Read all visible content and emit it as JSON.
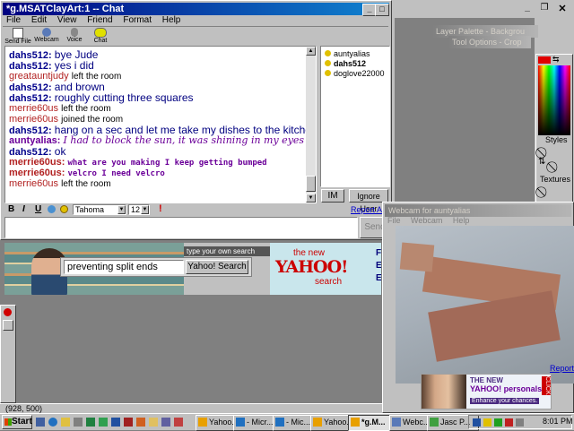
{
  "chat_window": {
    "title": "*g.MSATClayArt:1 -- Chat",
    "menu": [
      "File",
      "Edit",
      "View",
      "Friend",
      "Format",
      "Help"
    ],
    "toolbar": [
      {
        "label": "Send File",
        "icon": "send-file-icon"
      },
      {
        "label": "Webcam",
        "icon": "webcam-icon"
      },
      {
        "label": "Voice",
        "icon": "voice-icon"
      },
      {
        "label": "Chat",
        "icon": "chat-icon"
      }
    ],
    "messages": [
      {
        "nick": "dahs512:",
        "text": "bye Jude",
        "type": "msg"
      },
      {
        "nick": "dahs512:",
        "text": "yes i did",
        "type": "msg"
      },
      {
        "nick": "greatauntjudy",
        "text": "left the room",
        "type": "sys"
      },
      {
        "nick": "dahs512:",
        "text": "and brown",
        "type": "msg"
      },
      {
        "nick": "dahs512:",
        "text": "roughly cutting three squares",
        "type": "msg"
      },
      {
        "nick": "merrie60us",
        "text": "left the room",
        "type": "sys"
      },
      {
        "nick": "merrie60us",
        "text": "joined the room",
        "type": "sys"
      },
      {
        "nick": "dahs512:",
        "text": "hang on a sec and let me take my dishes to the kitchen",
        "type": "msg"
      },
      {
        "nick": "auntyalias:",
        "text": "I had to block the sun, it was shining in my eyes",
        "type": "script"
      },
      {
        "nick": "dahs512:",
        "text": "ok",
        "type": "msg"
      },
      {
        "nick": "merrie60us:",
        "text": "what are you making I keep getting bumped",
        "type": "purple"
      },
      {
        "nick": "merrie60us:",
        "text": "velcro I need velcro",
        "type": "purple"
      },
      {
        "nick": "merrie60us",
        "text": "left the room",
        "type": "sys"
      }
    ],
    "users": [
      {
        "name": "auntyalias",
        "bold": false
      },
      {
        "name": "dahs512",
        "bold": true
      },
      {
        "name": "doglove22000",
        "bold": false
      }
    ],
    "im_button": "IM",
    "ignore_button": "Ignore User",
    "format": {
      "bold": "B",
      "italic": "I",
      "underline": "U",
      "font": "Tahoma",
      "size": "12"
    },
    "report_abuse": "Report Abu",
    "send_button": "Send"
  },
  "ad": {
    "tag": "type your own search",
    "search_value": "preventing split ends",
    "search_button": "Yahoo! Search",
    "the_new": "the new",
    "brand": "YAHOO!",
    "search_word": "search",
    "side_letters": [
      "F",
      "E",
      "E"
    ]
  },
  "webcam": {
    "title": "Webcam for auntyalias",
    "menu": [
      "File",
      "Webcam",
      "Help"
    ],
    "report_abuse": "Report Al",
    "ad_new": "THE NEW",
    "ad_brand": "YAHOO! personals",
    "ad_sub": "Enhance your chances.",
    "ad_click": "CLICK"
  },
  "paint": {
    "layer_palette": "Layer Palette - Backgrou",
    "tool_options": "Tool Options - Crop",
    "styles_label": "Styles",
    "textures_label": "Textures"
  },
  "status": {
    "coords": "(928, 500)"
  },
  "taskbar": {
    "start": "Start",
    "tasks": [
      "Yahoo...",
      "- Micr...",
      "- Mic...",
      "Yahoo...",
      "*g.M...",
      "Webc...",
      "Jasc P..."
    ],
    "clock": "8:01 PM"
  },
  "colors": {
    "accent": "#000080",
    "desktop": "#808080",
    "brand_red": "#cc0000",
    "yahoo_purple": "#6b0099"
  }
}
